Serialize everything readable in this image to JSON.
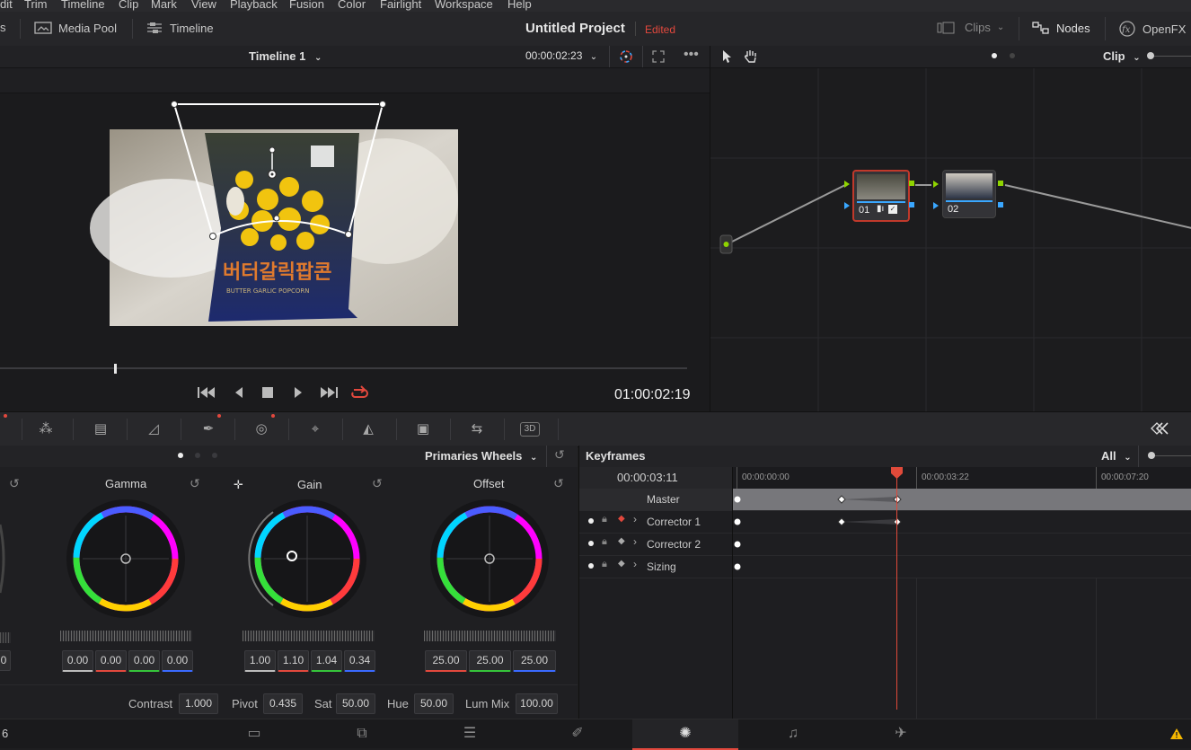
{
  "menu": [
    "dit",
    "Trim",
    "Timeline",
    "Clip",
    "Mark",
    "View",
    "Playback",
    "Fusion",
    "Color",
    "Fairlight",
    "Workspace",
    "Help"
  ],
  "toolbar": {
    "left_fragment": "s",
    "media_pool": "Media Pool",
    "timeline": "Timeline",
    "project_title": "Untitled Project",
    "edited": "Edited",
    "clips": "Clips",
    "nodes": "Nodes",
    "openfx": "OpenFX"
  },
  "viewer": {
    "timeline_name": "Timeline 1",
    "timecode_top": "00:00:02:23",
    "timecode_main": "01:00:02:19",
    "clip_label_lines": [
      "버터갈릭팝콘",
      "BUTTER GARLIC POPCORN"
    ]
  },
  "node_editor": {
    "mode": "Clip",
    "nodes": [
      {
        "label": "01",
        "selected": true
      },
      {
        "label": "02",
        "selected": false
      }
    ]
  },
  "color": {
    "mode": "Primaries Wheels",
    "wheels": [
      {
        "title": "Gamma",
        "values": [
          "0.00",
          "0.00",
          "0.00",
          "0.00"
        ]
      },
      {
        "title": "Gain",
        "values": [
          "1.00",
          "1.10",
          "1.04",
          "0.34"
        ]
      },
      {
        "title": "Offset",
        "values": [
          "25.00",
          "25.00",
          "25.00"
        ]
      }
    ],
    "lift_partial_value": "0",
    "adjust": [
      {
        "label": "Contrast",
        "value": "1.000"
      },
      {
        "label": "Pivot",
        "value": "0.435"
      },
      {
        "label": "Sat",
        "value": "50.00"
      },
      {
        "label": "Hue",
        "value": "50.00"
      },
      {
        "label": "Lum Mix",
        "value": "100.00"
      }
    ]
  },
  "keyframes": {
    "title": "Keyframes",
    "filter": "All",
    "current_tc": "00:00:03:11",
    "ruler": [
      "00:00:00:00",
      "00:00:03:22",
      "00:00:07:20"
    ],
    "tracks": [
      "Master",
      "Corrector 1",
      "Corrector 2",
      "Sizing"
    ]
  },
  "pagebar": {
    "left_fragment": "6"
  },
  "colors": {
    "accent_red": "#e2483d",
    "node_green": "#8fd400",
    "node_blue": "#3aa7ff",
    "playhead": "#e04a3a"
  }
}
